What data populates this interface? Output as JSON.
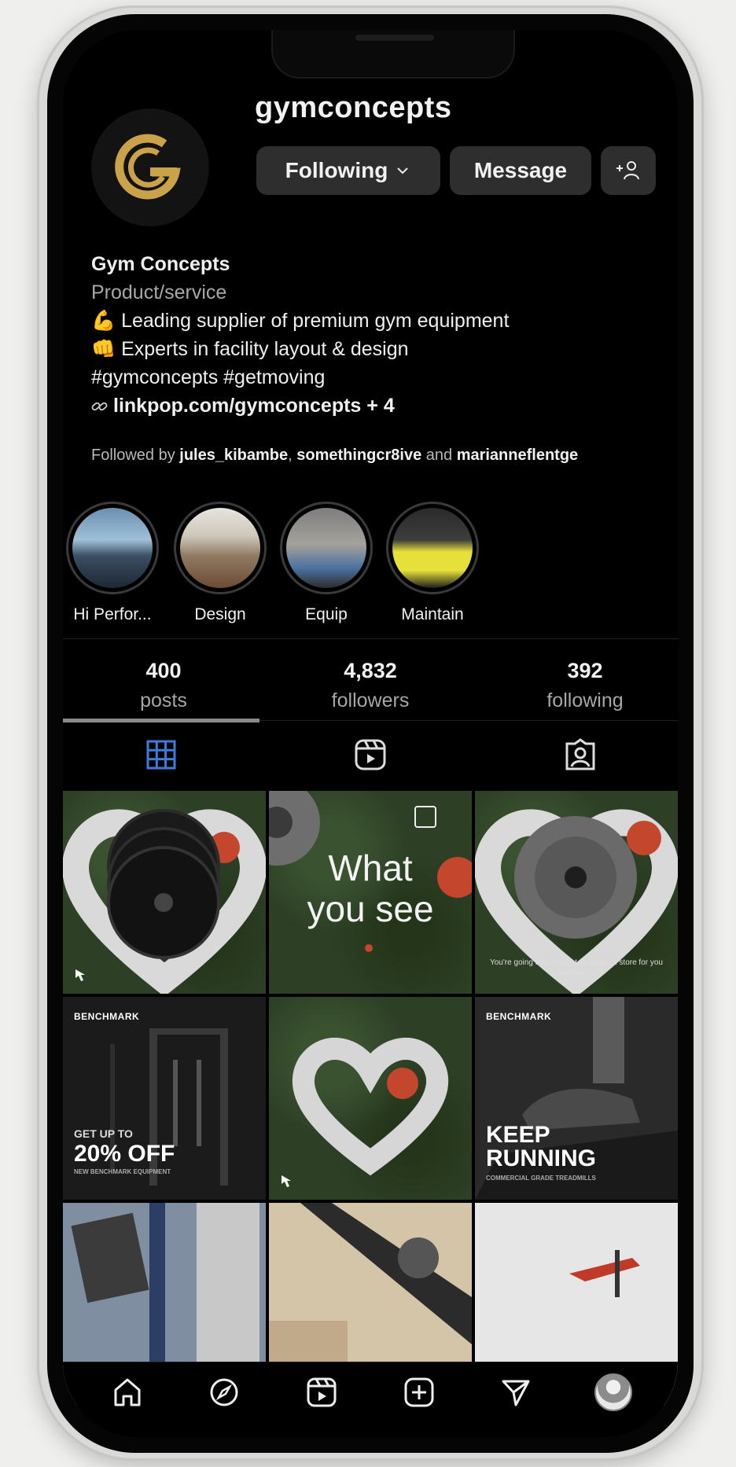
{
  "profile": {
    "username": "gymconcepts",
    "buttons": {
      "following": "Following",
      "message": "Message"
    },
    "bio": {
      "name": "Gym Concepts",
      "category": "Product/service",
      "lines": [
        "💪 Leading supplier of premium gym equipment",
        "👊 Experts in facility layout & design",
        "#gymconcepts #getmoving"
      ],
      "link": "linkpop.com/gymconcepts + 4"
    },
    "followed_by": {
      "prefix": "Followed by",
      "users": [
        "jules_kibambe",
        "somethingcr8ive",
        "marianneflentge"
      ],
      "separator": ", ",
      "conjunction": " and "
    }
  },
  "highlights": [
    {
      "label": "Hi Perfor..."
    },
    {
      "label": "Design"
    },
    {
      "label": "Equip"
    },
    {
      "label": "Maintain"
    }
  ],
  "stats": [
    {
      "value": "400",
      "label": "posts"
    },
    {
      "value": "4,832",
      "label": "followers"
    },
    {
      "value": "392",
      "label": "following"
    }
  ],
  "posts": {
    "post2": {
      "line1": "What",
      "line2": "you see"
    },
    "post3": {
      "caption": "You're going to love what we have in store for you this month"
    },
    "post4": {
      "brand": "BENCHMARK",
      "small": "GET UP TO",
      "big": "20% OFF",
      "fine": "NEW BENCHMARK EQUIPMENT"
    },
    "post6": {
      "brand": "BENCHMARK",
      "big1": "KEEP",
      "big2": "RUNNING",
      "fine": "COMMERCIAL GRADE TREADMILLS"
    }
  },
  "colors": {
    "accent_gold": "#c9a24a",
    "tab_active": "#3f7bd9",
    "background": "#000000"
  }
}
